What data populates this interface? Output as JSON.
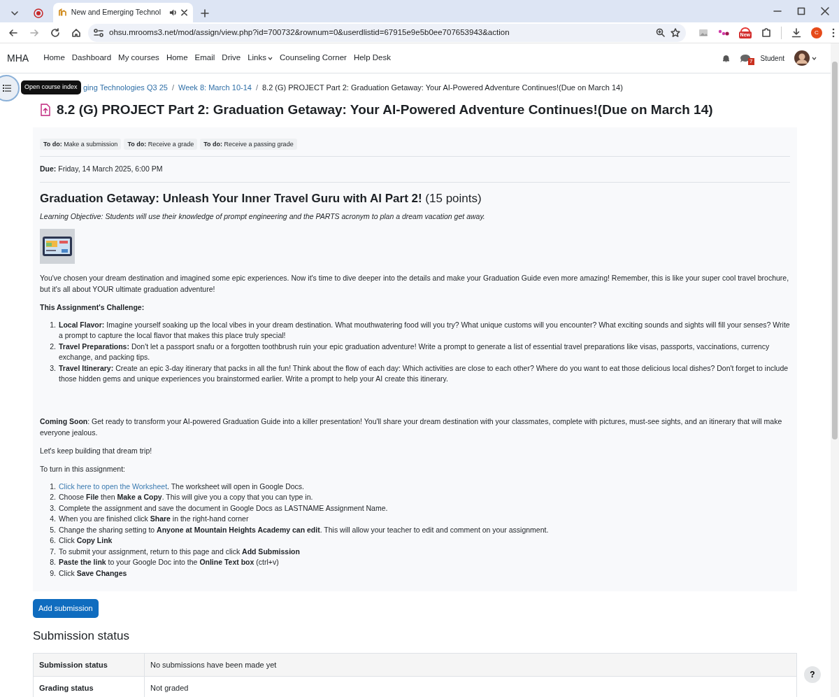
{
  "browser": {
    "tab_title": "New and Emerging Technol",
    "url": "ohsu.mrooms3.net/mod/assign/view.php?id=700732&rownum=0&userdlistid=67915e9e5b0ee707653943&action",
    "extension_badge": "New",
    "profile_initial": "C"
  },
  "navbar": {
    "brand": "MHA",
    "items": [
      {
        "label": "Home",
        "dropdown": false
      },
      {
        "label": "Dashboard",
        "dropdown": false
      },
      {
        "label": "My courses",
        "dropdown": false
      },
      {
        "label": "Home",
        "dropdown": false
      },
      {
        "label": "Email",
        "dropdown": false
      },
      {
        "label": "Drive",
        "dropdown": false
      },
      {
        "label": "Links",
        "dropdown": true
      },
      {
        "label": "Counseling Corner",
        "dropdown": false
      },
      {
        "label": "Help Desk",
        "dropdown": false
      }
    ],
    "message_count": "7",
    "user": "Student"
  },
  "course_index_tooltip": "Open course index",
  "breadcrumb": [
    {
      "label": "ging Technologies Q3 25",
      "link": true
    },
    {
      "separator": "/",
      "label": "Week 8: March 10-14",
      "link": true
    },
    {
      "separator": "/",
      "label": "8.2 (G) PROJECT Part 2: Graduation Getaway: Your AI-Powered Adventure Continues!(Due on March 14)",
      "link": false
    }
  ],
  "page_title": "8.2 (G) PROJECT Part 2: Graduation Getaway: Your AI-Powered Adventure Continues!(Due on March 14)",
  "todos": [
    {
      "label": "To do:",
      "text": "Make a submission"
    },
    {
      "label": "To do:",
      "text": "Receive a grade"
    },
    {
      "label": "To do:",
      "text": "Receive a passing grade"
    }
  ],
  "due": {
    "label": "Due:",
    "text": "Friday, 14 March 2025, 6:00 PM"
  },
  "description": {
    "heading": "**Graduation Getaway: Unleash Your Inner Travel Guru with AI Part 2!** (15 points)",
    "objective": "Learning Objective: Students will use their knowledge of prompt engineering and the PARTS acronym to plan a dream vacation get away.",
    "intro": "You've chosen your dream destination and imagined some epic experiences. Now it's time to dive deeper into the details and make your Graduation Guide even more amazing! Remember, this is like your super cool travel brochure, but it's all about YOUR ultimate graduation adventure!",
    "challenge_heading": "This Assignment's Challenge:",
    "challenges": [
      {
        "number": "1.",
        "text": "**Local Flavor:** Imagine yourself soaking up the local vibes in your dream destination. What mouthwatering food will you try? What unique customs will you encounter? What exciting sounds and sights will fill your senses? Write a prompt to capture the local flavor that makes this place truly special!"
      },
      {
        "number": "2.",
        "text": "**Travel Preparations:** Don't let a passport snafu or a forgotten toothbrush ruin your epic graduation adventure! Write a prompt to generate a list of essential travel preparations like visas, passports, vaccinations, currency exchange, and packing tips."
      },
      {
        "number": "3.",
        "text": "**Travel Itinerary:** Create an epic 3-day itinerary that packs in all the fun! Think about the flow of each day: Which activities are close to each other? Where do you want to eat those delicious local dishes? Don't forget to include those hidden gems and unique experiences you brainstormed earlier. Write a prompt to help your AI create this itinerary."
      }
    ],
    "coming_soon": "**Coming Soon**: Get ready to transform your AI-powered Graduation Guide into a killer presentation! You'll share your dream destination with your classmates, complete with pictures, must-see sights, and an itinerary that will make everyone jealous.",
    "closing": "Let's keep building that dream trip!",
    "steps_heading": "To turn in this assignment:",
    "steps": [
      {
        "number": "1.",
        "link": "Click here to open the Worksheet",
        "text": ". The worksheet will open in Google Docs."
      },
      {
        "number": "2.",
        "text": "Choose **File** then **Make a Copy**. This will give you a copy that you can type in."
      },
      {
        "number": "3.",
        "text": "Complete the assignment and save the document in Google Docs as LASTNAME Assignment Name."
      },
      {
        "number": "4.",
        "text": "When you are finished click **Share** in the right-hand corner"
      },
      {
        "number": "5.",
        "text": "Change the sharing setting to **Anyone at Mountain Heights Academy can edit**. This will allow your teacher to edit and comment on your assignment."
      },
      {
        "number": "6.",
        "text": "Click **Copy Link**"
      },
      {
        "number": "7.",
        "text": "To submit your assignment, return to this page and click **Add Submission**"
      },
      {
        "number": "8.",
        "text": "**Paste the link** to your Google Doc into the **Online Text box** (ctrl+v)"
      },
      {
        "number": "9.",
        "text": "Click **Save Changes**"
      }
    ]
  },
  "add_submission_button": "Add submission",
  "submission_status": {
    "heading": "Submission status",
    "rows": [
      {
        "label": "Submission status",
        "value": "No submissions have been made yet"
      },
      {
        "label": "Grading status",
        "value": "Not graded"
      }
    ]
  },
  "help_button": "?"
}
